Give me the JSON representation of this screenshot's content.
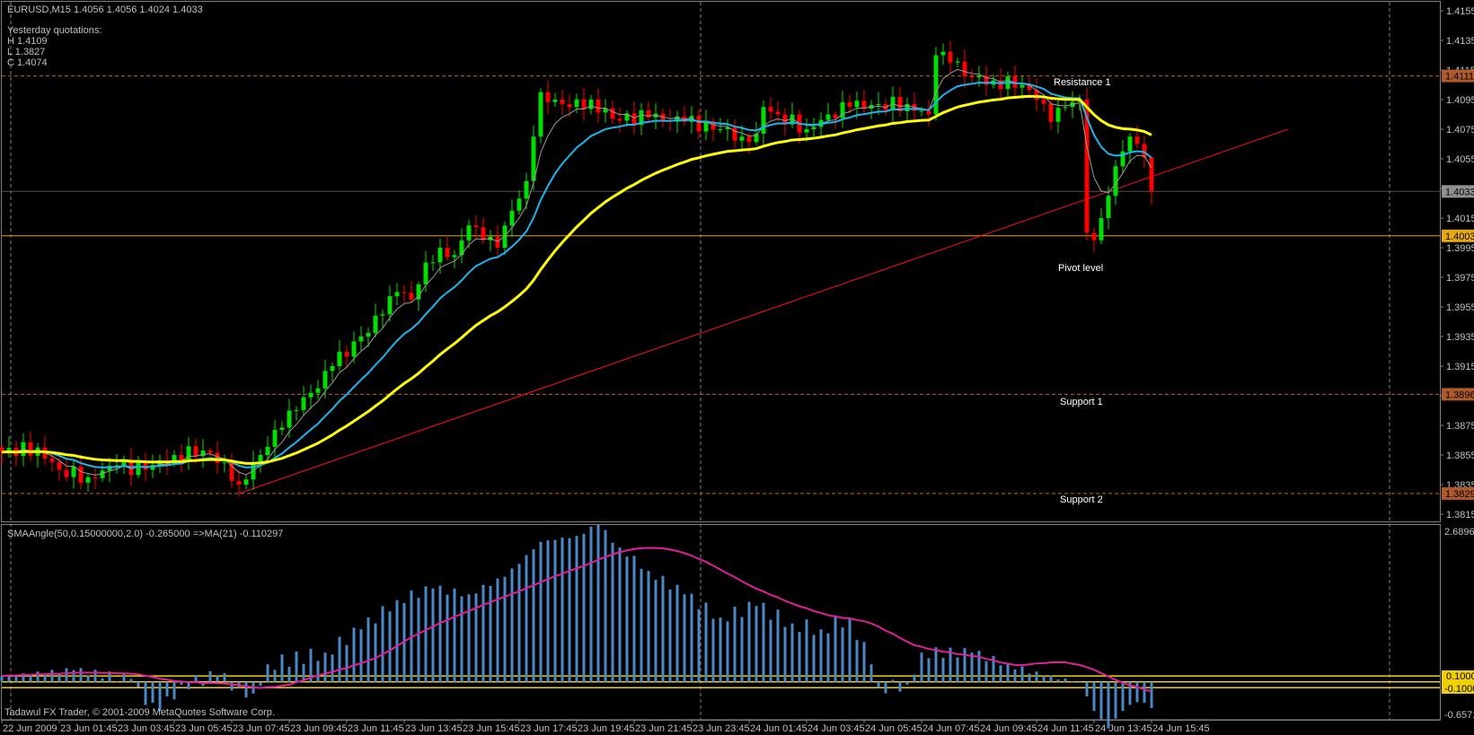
{
  "header": {
    "symbol_line": "EURUSD,M15  1.4056 1.4056 1.4024 1.4033",
    "yesterday_title": "Yesterday quotations:",
    "high": "H 1.4109",
    "low": "L 1.3827",
    "close": "C 1.4074"
  },
  "levels": {
    "resistance1": {
      "label": "Resistance 1",
      "price": 1.4111,
      "tag": "1.4111"
    },
    "pivot": {
      "label": "Pivot level",
      "price": 1.4003,
      "tag": "1.4003"
    },
    "support1": {
      "label": "Support 1",
      "price": 1.3896,
      "tag": "1.3896"
    },
    "support2": {
      "label": "Support 2",
      "price": 1.3829,
      "tag": "1.3829"
    },
    "current": {
      "price": 1.4033,
      "tag": "1.4033"
    }
  },
  "indicator": {
    "label": "SMAAngle(50,0.15000000,2.0) -0.265000  =>MA(21) -0.110297",
    "scale_max": "2.689625",
    "scale_min": "-0.65712",
    "level_hi": "0.1000",
    "level_lo": "-0.1000"
  },
  "footer": {
    "copyright": "Tadawul FX Trader, © 2001-2009 MetaQuotes Software Corp."
  },
  "colors": {
    "bull": "#00e000",
    "bear": "#ff0000",
    "ma_fast": "#9a9a9a",
    "ma_mid": "#1eb4f0",
    "ma_slow": "#ffff00",
    "trend": "#ff1010",
    "dashed_level": "#c8602a",
    "pivot": "#e8a010",
    "hist": "#4a88c8",
    "hist_ma": "#e0209a",
    "ind_level": "#f0d000"
  },
  "chart_data": {
    "type": "candlestick",
    "title": "EURUSD,M15",
    "ylim": [
      1.3815,
      1.4155
    ],
    "price_ticks": [
      "1.4155",
      "1.4135",
      "1.4115",
      "1.4095",
      "1.4075",
      "1.4055",
      "1.4035",
      "1.4015",
      "1.3995",
      "1.3975",
      "1.3955",
      "1.3935",
      "1.3915",
      "1.3895",
      "1.3875",
      "1.3855",
      "1.3835",
      "1.3815"
    ],
    "time_labels": [
      "22 Jun 2009",
      "23 Jun 01:45",
      "23 Jun 03:45",
      "23 Jun 05:45",
      "23 Jun 07:45",
      "23 Jun 09:45",
      "23 Jun 11:45",
      "23 Jun 13:45",
      "23 Jun 15:45",
      "23 Jun 17:45",
      "23 Jun 19:45",
      "23 Jun 21:45",
      "23 Jun 23:45",
      "24 Jun 01:45",
      "24 Jun 03:45",
      "24 Jun 05:45",
      "24 Jun 07:45",
      "24 Jun 09:45",
      "24 Jun 11:45",
      "24 Jun 13:45",
      "24 Jun 15:45"
    ],
    "bar_count": 161,
    "close_path": [
      [
        0,
        1.3857
      ],
      [
        5,
        1.386
      ],
      [
        8,
        1.3845
      ],
      [
        12,
        1.384
      ],
      [
        16,
        1.3848
      ],
      [
        20,
        1.3845
      ],
      [
        24,
        1.3855
      ],
      [
        28,
        1.3858
      ],
      [
        31,
        1.385
      ],
      [
        33,
        1.3835
      ],
      [
        36,
        1.3855
      ],
      [
        38,
        1.3872
      ],
      [
        40,
        1.3885
      ],
      [
        44,
        1.39
      ],
      [
        46,
        1.3915
      ],
      [
        50,
        1.3935
      ],
      [
        53,
        1.395
      ],
      [
        55,
        1.3965
      ],
      [
        57,
        1.396
      ],
      [
        59,
        1.3985
      ],
      [
        61,
        1.3995
      ],
      [
        63,
        1.399
      ],
      [
        65,
        1.401
      ],
      [
        67,
        1.4
      ],
      [
        69,
        1.3995
      ],
      [
        71,
        1.402
      ],
      [
        73,
        1.404
      ],
      [
        74,
        1.407
      ],
      [
        75,
        1.41
      ],
      [
        77,
        1.4095
      ],
      [
        79,
        1.409
      ],
      [
        82,
        1.4095
      ],
      [
        85,
        1.4082
      ],
      [
        90,
        1.4083
      ],
      [
        95,
        1.408
      ],
      [
        100,
        1.4075
      ],
      [
        103,
        1.407
      ],
      [
        105,
        1.4072
      ],
      [
        106,
        1.409
      ],
      [
        108,
        1.4085
      ],
      [
        112,
        1.4075
      ],
      [
        115,
        1.4085
      ],
      [
        118,
        1.409
      ],
      [
        122,
        1.4092
      ],
      [
        126,
        1.4092
      ],
      [
        129,
        1.4085
      ],
      [
        130,
        1.4125
      ],
      [
        132,
        1.412
      ],
      [
        135,
        1.411
      ],
      [
        138,
        1.4108
      ],
      [
        142,
        1.4105
      ],
      [
        144,
        1.4095
      ],
      [
        146,
        1.408
      ],
      [
        148,
        1.409
      ],
      [
        150,
        1.4095
      ],
      [
        151,
        1.4005
      ],
      [
        152,
        1.4
      ],
      [
        153,
        1.4015
      ],
      [
        154,
        1.403
      ],
      [
        155,
        1.405
      ],
      [
        156,
        1.406
      ],
      [
        157,
        1.407
      ],
      [
        158,
        1.4065
      ],
      [
        159,
        1.4056
      ],
      [
        160,
        1.4033
      ]
    ],
    "last_bar": {
      "open": 1.4056,
      "high": 1.4056,
      "low": 1.4024,
      "close": 1.4033
    },
    "ma_periods": {
      "fast": 5,
      "mid": 13,
      "slow": 34
    },
    "trendline": [
      [
        33,
        1.3829
      ],
      [
        179,
        1.4075
      ]
    ],
    "indicator_ylim": [
      -0.65712,
      2.689625
    ],
    "indicator_levels": [
      0.1,
      -0.1
    ],
    "hist_path": [
      [
        0,
        0.1
      ],
      [
        10,
        0.2
      ],
      [
        18,
        0.05
      ],
      [
        20,
        -0.4
      ],
      [
        22,
        -0.5
      ],
      [
        25,
        -0.05
      ],
      [
        30,
        0.1
      ],
      [
        33,
        -0.1
      ],
      [
        35,
        -0.2
      ],
      [
        37,
        0.3
      ],
      [
        45,
        0.5
      ],
      [
        50,
        0.9
      ],
      [
        55,
        1.4
      ],
      [
        60,
        1.6
      ],
      [
        65,
        1.5
      ],
      [
        70,
        1.8
      ],
      [
        75,
        2.4
      ],
      [
        80,
        2.5
      ],
      [
        83,
        2.69
      ],
      [
        86,
        2.3
      ],
      [
        90,
        1.9
      ],
      [
        95,
        1.5
      ],
      [
        100,
        1.1
      ],
      [
        105,
        1.3
      ],
      [
        110,
        1.0
      ],
      [
        114,
        0.9
      ],
      [
        118,
        1.1
      ],
      [
        121,
        0.3
      ],
      [
        122,
        -0.1
      ],
      [
        126,
        -0.05
      ],
      [
        128,
        0.5
      ],
      [
        135,
        0.5
      ],
      [
        140,
        0.3
      ],
      [
        145,
        0.1
      ],
      [
        150,
        0.0
      ],
      [
        152,
        -0.5
      ],
      [
        154,
        -0.8
      ],
      [
        156,
        -0.5
      ],
      [
        158,
        -0.35
      ],
      [
        160,
        -0.45
      ]
    ],
    "hist_ma_period": 21
  }
}
